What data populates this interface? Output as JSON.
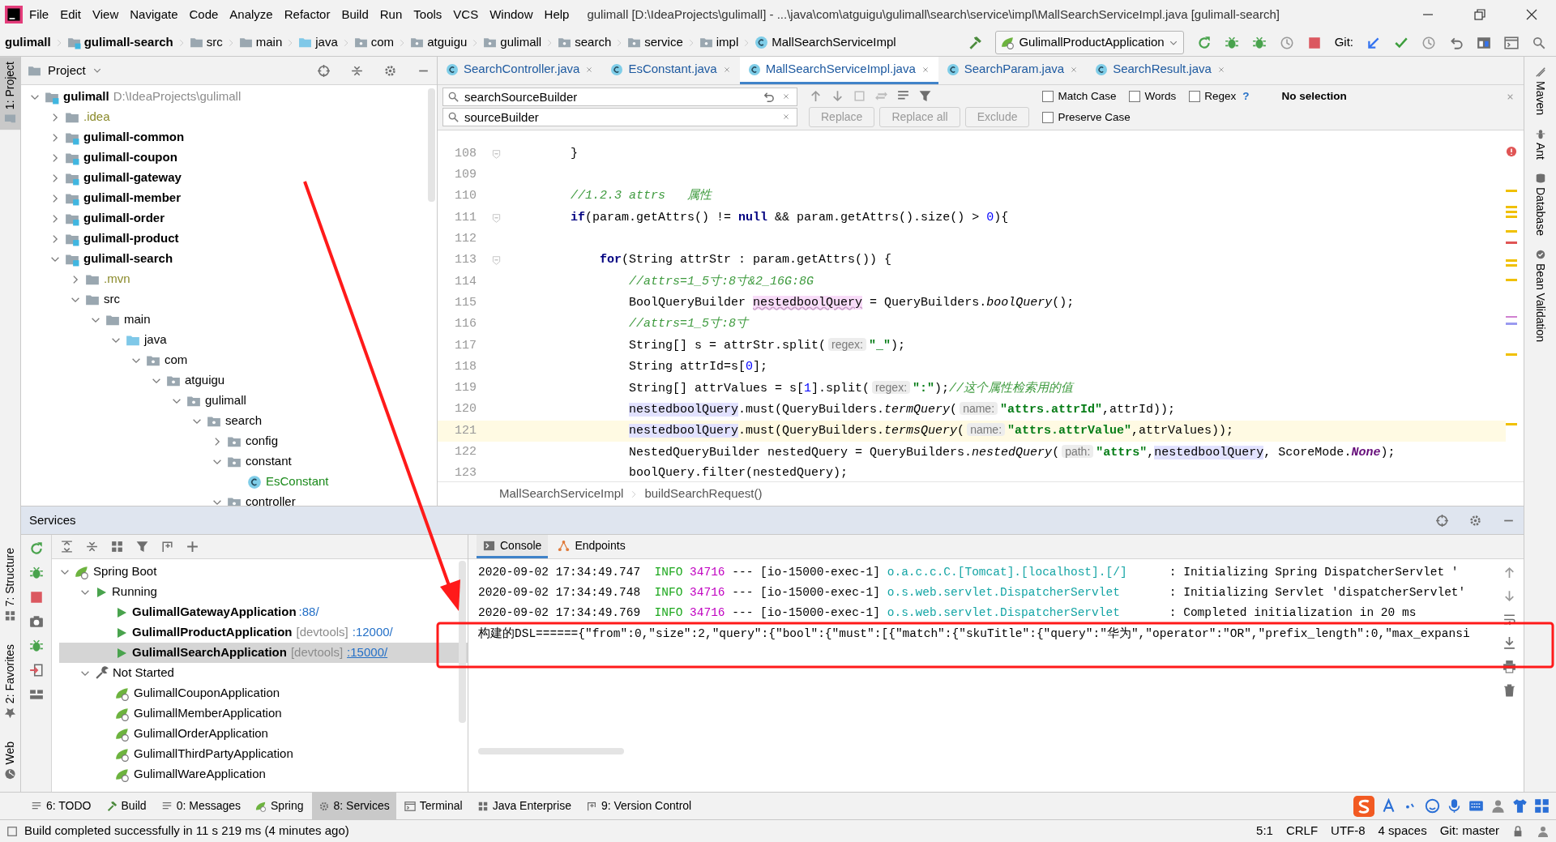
{
  "menu_bar": {
    "items": [
      "File",
      "Edit",
      "View",
      "Navigate",
      "Code",
      "Analyze",
      "Refactor",
      "Build",
      "Run",
      "Tools",
      "VCS",
      "Window",
      "Help"
    ],
    "title": "gulimall [D:\\IdeaProjects\\gulimall] - ...\\java\\com\\atguigu\\gulimall\\search\\service\\impl\\MallSearchServiceImpl.java [gulimall-search]"
  },
  "nav_bar": {
    "crumbs": [
      {
        "label": "gulimall",
        "kind": "project"
      },
      {
        "label": "gulimall-search",
        "kind": "module"
      },
      {
        "label": "src",
        "kind": "folder"
      },
      {
        "label": "main",
        "kind": "folder"
      },
      {
        "label": "java",
        "kind": "source"
      },
      {
        "label": "com",
        "kind": "package"
      },
      {
        "label": "atguigu",
        "kind": "package"
      },
      {
        "label": "gulimall",
        "kind": "package"
      },
      {
        "label": "search",
        "kind": "package"
      },
      {
        "label": "service",
        "kind": "package"
      },
      {
        "label": "impl",
        "kind": "package"
      },
      {
        "label": "MallSearchServiceImpl",
        "kind": "class"
      }
    ],
    "run_config": "GulimallProductApplication",
    "vcs_label": "Git:"
  },
  "left_strip": {
    "top_tabs": [
      {
        "label": "1: Project",
        "selected": true
      }
    ],
    "bottom_tabs": [
      {
        "label": "7: Structure",
        "selected": false
      },
      {
        "label": "2: Favorites",
        "selected": false
      },
      {
        "label": "Web",
        "selected": false
      }
    ]
  },
  "right_strip": {
    "tabs": [
      "Maven",
      "Ant",
      "Database",
      "Bean Validation"
    ]
  },
  "project_panel": {
    "title": "Project",
    "tree": [
      {
        "label": "gulimall",
        "kind": "module",
        "path": "D:\\IdeaProjects\\gulimall",
        "expanded": true,
        "children": [
          {
            "label": ".idea",
            "kind": "ignored",
            "expanded": false
          },
          {
            "label": "gulimall-common",
            "kind": "module",
            "expanded": false
          },
          {
            "label": "gulimall-coupon",
            "kind": "module",
            "expanded": false
          },
          {
            "label": "gulimall-gateway",
            "kind": "module",
            "expanded": false
          },
          {
            "label": "gulimall-member",
            "kind": "module",
            "expanded": false
          },
          {
            "label": "gulimall-order",
            "kind": "module",
            "expanded": false
          },
          {
            "label": "gulimall-product",
            "kind": "module",
            "expanded": false
          },
          {
            "label": "gulimall-search",
            "kind": "module",
            "expanded": true,
            "children": [
              {
                "label": ".mvn",
                "kind": "ignored",
                "expanded": false
              },
              {
                "label": "src",
                "kind": "folder",
                "expanded": true,
                "children": [
                  {
                    "label": "main",
                    "kind": "folder",
                    "expanded": true,
                    "children": [
                      {
                        "label": "java",
                        "kind": "source",
                        "expanded": true,
                        "children": [
                          {
                            "label": "com",
                            "kind": "package",
                            "expanded": true,
                            "children": [
                              {
                                "label": "atguigu",
                                "kind": "package",
                                "expanded": true,
                                "children": [
                                  {
                                    "label": "gulimall",
                                    "kind": "package",
                                    "expanded": true,
                                    "children": [
                                      {
                                        "label": "search",
                                        "kind": "package",
                                        "expanded": true,
                                        "children": [
                                          {
                                            "label": "config",
                                            "kind": "package",
                                            "expanded": false
                                          },
                                          {
                                            "label": "constant",
                                            "kind": "package",
                                            "expanded": true,
                                            "children": [
                                              {
                                                "label": "EsConstant",
                                                "kind": "class"
                                              }
                                            ]
                                          },
                                          {
                                            "label": "controller",
                                            "kind": "package",
                                            "expanded": true
                                          }
                                        ]
                                      }
                                    ]
                                  }
                                ]
                              }
                            ]
                          }
                        ]
                      }
                    ]
                  }
                ]
              }
            ]
          }
        ]
      }
    ]
  },
  "editor": {
    "tabs": [
      {
        "label": "SearchController.java",
        "selected": false
      },
      {
        "label": "EsConstant.java",
        "selected": false
      },
      {
        "label": "MallSearchServiceImpl.java",
        "selected": true
      },
      {
        "label": "SearchParam.java",
        "selected": false
      },
      {
        "label": "SearchResult.java",
        "selected": false
      }
    ],
    "find": {
      "search": "searchSourceBuilder",
      "replace": "sourceBuilder",
      "buttons": [
        {
          "label": "Replace",
          "disabled": true
        },
        {
          "label": "Replace all",
          "disabled": true
        },
        {
          "label": "Exclude",
          "disabled": true
        }
      ],
      "options": [
        {
          "label": "Match Case",
          "checked": false
        },
        {
          "label": "Words",
          "checked": false
        },
        {
          "label": "Regex",
          "checked": false
        }
      ],
      "help": "?",
      "preserve": {
        "label": "Preserve Case",
        "checked": false
      },
      "status": "No selection"
    },
    "lines": [
      {
        "number": "108",
        "current": false,
        "fold": true,
        "segments": [
          {
            "kind": "plain",
            "text": "        }"
          }
        ]
      },
      {
        "number": "109",
        "current": false,
        "fold": false
      },
      {
        "number": "110",
        "current": false,
        "fold": false,
        "segments": [
          {
            "kind": "comment",
            "text": "        //1.2.3 attrs   属性"
          }
        ]
      },
      {
        "number": "111",
        "current": false,
        "fold": true,
        "segments": [
          {
            "kind": "keyword",
            "text": "        if"
          },
          {
            "kind": "plain",
            "text": "(param.getAttrs() != "
          },
          {
            "kind": "keyword",
            "text": "null"
          },
          {
            "kind": "plain",
            "text": " && param.getAttrs().size() > "
          },
          {
            "kind": "number",
            "text": "0"
          },
          {
            "kind": "plain",
            "text": "){"
          }
        ]
      },
      {
        "number": "112",
        "current": false,
        "fold": false
      },
      {
        "number": "113",
        "current": false,
        "fold": true,
        "segments": [
          {
            "kind": "keyword",
            "text": "            for"
          },
          {
            "kind": "plain",
            "text": "(String attrStr : param.getAttrs()) {"
          }
        ]
      },
      {
        "number": "114",
        "current": false,
        "fold": false,
        "segments": [
          {
            "kind": "comment",
            "text": "                //attrs=1_5寸:8寸&2_16G:8G"
          }
        ]
      },
      {
        "number": "115",
        "current": false,
        "fold": false,
        "segments": [
          {
            "kind": "plain",
            "text": "                BoolQueryBuilder "
          },
          {
            "kind": "declaration",
            "text": "nestedboolQuery"
          },
          {
            "kind": "plain",
            "text": " = QueryBuilders."
          },
          {
            "kind": "italic",
            "text": "boolQuery"
          },
          {
            "kind": "plain",
            "text": "();"
          }
        ]
      },
      {
        "number": "116",
        "current": false,
        "fold": false,
        "segments": [
          {
            "kind": "comment",
            "text": "                //attrs=1_5寸:8寸"
          }
        ]
      },
      {
        "number": "117",
        "current": false,
        "fold": false,
        "segments": [
          {
            "kind": "plain",
            "text": "                String[] s = attrStr.split("
          },
          {
            "kind": "hint",
            "text": "regex:"
          },
          {
            "kind": "string",
            "text": "\"_\""
          },
          {
            "kind": "plain",
            "text": ");"
          }
        ]
      },
      {
        "number": "118",
        "current": false,
        "fold": false,
        "segments": [
          {
            "kind": "plain",
            "text": "                String attrId=s["
          },
          {
            "kind": "number",
            "text": "0"
          },
          {
            "kind": "plain",
            "text": "];"
          }
        ]
      },
      {
        "number": "119",
        "current": false,
        "fold": false,
        "segments": [
          {
            "kind": "plain",
            "text": "                String[] attrValues = s["
          },
          {
            "kind": "number",
            "text": "1"
          },
          {
            "kind": "plain",
            "text": "].split("
          },
          {
            "kind": "hint",
            "text": "regex:"
          },
          {
            "kind": "string",
            "text": "\":\""
          },
          {
            "kind": "plain",
            "text": ");"
          },
          {
            "kind": "comment",
            "text": "//这个属性检索用的值"
          }
        ]
      },
      {
        "number": "120",
        "current": false,
        "fold": false,
        "segments": [
          {
            "kind": "usage",
            "text": "                nestedboolQuery"
          },
          {
            "kind": "plain",
            "text": ".must(QueryBuilders."
          },
          {
            "kind": "italic",
            "text": "termQuery"
          },
          {
            "kind": "plain",
            "text": "("
          },
          {
            "kind": "hint",
            "text": "name:"
          },
          {
            "kind": "string",
            "text": "\"attrs.attrId\""
          },
          {
            "kind": "plain",
            "text": ",attrId));"
          }
        ]
      },
      {
        "number": "121",
        "current": true,
        "fold": false,
        "segments": [
          {
            "kind": "usage",
            "text": "                nestedboolQuery"
          },
          {
            "kind": "plain",
            "text": ".must(QueryBuilders."
          },
          {
            "kind": "italic",
            "text": "termsQuery"
          },
          {
            "kind": "plain",
            "text": "("
          },
          {
            "kind": "hint",
            "text": "name:"
          },
          {
            "kind": "string",
            "text": "\"attrs.attrValue\""
          },
          {
            "kind": "plain",
            "text": ",attrValues));"
          }
        ]
      },
      {
        "number": "122",
        "current": false,
        "fold": false,
        "segments": [
          {
            "kind": "plain",
            "text": "                NestedQueryBuilder nestedQuery = QueryBuilders."
          },
          {
            "kind": "italic",
            "text": "nestedQuery"
          },
          {
            "kind": "plain",
            "text": "("
          },
          {
            "kind": "hint",
            "text": "path:"
          },
          {
            "kind": "string",
            "text": "\"attrs\""
          },
          {
            "kind": "plain",
            "text": ","
          },
          {
            "kind": "usage",
            "text": "nestedboolQuery"
          },
          {
            "kind": "plain",
            "text": ", ScoreMode."
          },
          {
            "kind": "constant",
            "text": "None"
          },
          {
            "kind": "plain",
            "text": ");"
          }
        ]
      },
      {
        "number": "123",
        "current": false,
        "fold": false,
        "segments": [
          {
            "kind": "plain",
            "text": "                boolQuery.filter(nestedQuery);"
          }
        ]
      }
    ],
    "breadcrumbs": [
      "MallSearchServiceImpl",
      "buildSearchRequest()"
    ]
  },
  "services": {
    "title": "Services",
    "tree": [
      {
        "label": "Spring Boot",
        "kind": "spring",
        "expanded": true,
        "children": [
          {
            "label": "Running",
            "kind": "running-group",
            "expanded": true,
            "children": [
              {
                "label": "GulimallGatewayApplication",
                "kind": "running-app",
                "port": ":88/",
                "selected": false
              },
              {
                "label": "GulimallProductApplication",
                "kind": "running-app",
                "tag": "[devtools]",
                "port": ":12000/",
                "selected": false
              },
              {
                "label": "GulimallSearchApplication",
                "kind": "running-app",
                "tag": "[devtools]",
                "port": ":15000/",
                "selected": true
              }
            ]
          },
          {
            "label": "Not Started",
            "kind": "stopped-group",
            "expanded": true,
            "children": [
              {
                "label": "GulimallCouponApplication",
                "kind": "app",
                "selected": false
              },
              {
                "label": "GulimallMemberApplication",
                "kind": "app",
                "selected": false
              },
              {
                "label": "GulimallOrderApplication",
                "kind": "app",
                "selected": false
              },
              {
                "label": "GulimallThirdPartyApplication",
                "kind": "app",
                "selected": false
              },
              {
                "label": "GulimallWareApplication",
                "kind": "app",
                "selected": false
              }
            ]
          }
        ]
      }
    ],
    "console_tabs": [
      {
        "label": "Console",
        "selected": true
      },
      {
        "label": "Endpoints",
        "selected": false
      }
    ],
    "log": [
      {
        "kind": "log",
        "time": "2020-09-02 17:34:49.747",
        "level": "INFO",
        "pid": "34716",
        "sep": "---",
        "thread": "[io-15000-exec-1]",
        "logger": "o.a.c.c.C.[Tomcat].[localhost].[/]",
        "message": ": Initializing Spring DispatcherServlet '"
      },
      {
        "kind": "log",
        "time": "2020-09-02 17:34:49.748",
        "level": "INFO",
        "pid": "34716",
        "sep": "---",
        "thread": "[io-15000-exec-1]",
        "logger": "o.s.web.servlet.DispatcherServlet",
        "message": ": Initializing Servlet 'dispatcherServlet'"
      },
      {
        "kind": "log",
        "time": "2020-09-02 17:34:49.769",
        "level": "INFO",
        "pid": "34716",
        "sep": "---",
        "thread": "[io-15000-exec-1]",
        "logger": "o.s.web.servlet.DispatcherServlet",
        "message": ": Completed initialization in 20 ms"
      },
      {
        "kind": "text",
        "text": "构建的DSL======{\"from\":0,\"size\":2,\"query\":{\"bool\":{\"must\":[{\"match\":{\"skuTitle\":{\"query\":\"华为\",\"operator\":\"OR\",\"prefix_length\":0,\"max_expansi"
      }
    ]
  },
  "bottom_tabs": [
    {
      "label": "6: TODO",
      "selected": false
    },
    {
      "label": "Build",
      "selected": false
    },
    {
      "label": "0: Messages",
      "selected": false
    },
    {
      "label": "Spring",
      "selected": false
    },
    {
      "label": "8: Services",
      "selected": true
    },
    {
      "label": "Terminal",
      "selected": false
    },
    {
      "label": "Java Enterprise",
      "selected": false
    },
    {
      "label": "9: Version Control",
      "selected": false
    }
  ],
  "status_bar": {
    "message": "Build completed successfully in 11 s 219 ms (4 minutes ago)",
    "items": [
      "5:1",
      "CRLF",
      "UTF-8",
      "4 spaces",
      "Git: master"
    ]
  }
}
